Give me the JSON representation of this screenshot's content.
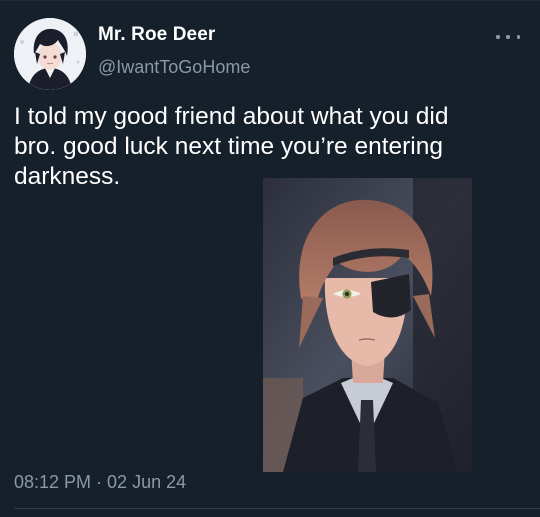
{
  "author": {
    "name": "Mr. Roe Deer",
    "handle": "@IwantToGoHome"
  },
  "tweet": {
    "text": "I told my good friend about what you did\nbro. good luck next time you’re entering\ndarkness.",
    "timestamp": "08:12 PM · 02 Jun 24"
  },
  "icons": {
    "more": "more-horizontal-icon"
  },
  "colors": {
    "background": "#15202b",
    "primary_text": "#ffffff",
    "secondary_text": "#8b98a5"
  }
}
